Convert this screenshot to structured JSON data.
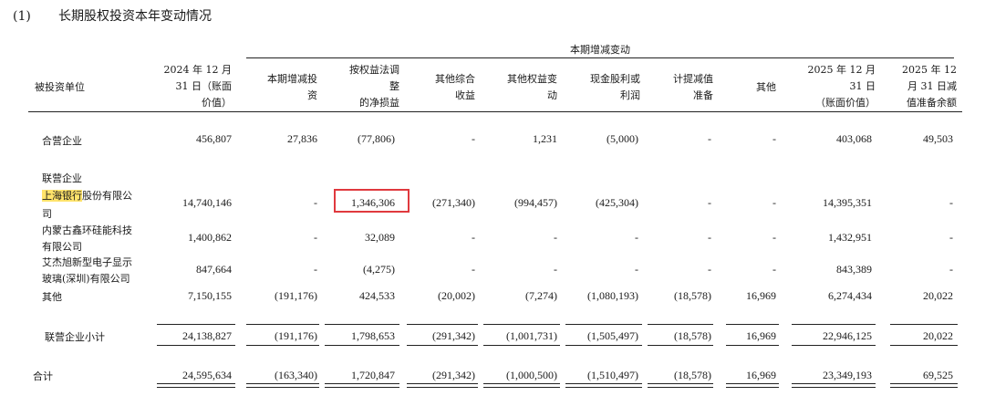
{
  "title": {
    "number": "(1)",
    "text": "长期股权投资本年变动情况"
  },
  "header": {
    "group": "本期增减变动",
    "col_investee": "被投资单位",
    "col_open": [
      "2024 年 12 月",
      "31 日（账面",
      "价值）"
    ],
    "col_increase": [
      "本期增减投",
      "资"
    ],
    "col_equity": [
      "按权益法调",
      "整",
      "的净损益"
    ],
    "col_oci": [
      "其他综合",
      "收益"
    ],
    "col_other_eq": [
      "其他权益变",
      "动"
    ],
    "col_dividend": [
      "现金股利或",
      "利润"
    ],
    "col_impair": [
      "计提减值",
      "准备"
    ],
    "col_other": [
      "其他"
    ],
    "col_close": [
      "2025 年 12 月",
      "31 日",
      "（账面价值）"
    ],
    "col_close_impair": [
      "2025 年 12",
      "月 31 日减",
      "值准备余额"
    ]
  },
  "rows": {
    "jv": {
      "name": "合营企业",
      "open": "456,807",
      "increase": "27,836",
      "equity": "(77,806)",
      "oci": "-",
      "other_eq": "1,231",
      "dividend": "(5,000)",
      "impair": "-",
      "other": "-",
      "close": "403,068",
      "close_impair": "49,503"
    },
    "assoc_label": "联营企业",
    "bank": {
      "name_hl": "上海银行",
      "name_rest": "股份有限公",
      "name2": "司",
      "open": "14,740,146",
      "increase": "-",
      "equity": "1,346,306",
      "oci": "(271,340)",
      "other_eq": "(994,457)",
      "dividend": "(425,304)",
      "impair": "-",
      "other": "-",
      "close": "14,395,351",
      "close_impair": "-"
    },
    "nmg": {
      "name1": "内蒙古鑫环硅能科技",
      "name2": "有限公司",
      "open": "1,400,862",
      "increase": "-",
      "equity": "32,089",
      "oci": "-",
      "other_eq": "-",
      "dividend": "-",
      "impair": "-",
      "other": "-",
      "close": "1,432,951",
      "close_impair": "-"
    },
    "ajx": {
      "name1": "艾杰旭新型电子显示",
      "name2": "玻璃(深圳)有限公司",
      "open": "847,664",
      "increase": "-",
      "equity": "(4,275)",
      "oci": "-",
      "other_eq": "-",
      "dividend": "-",
      "impair": "-",
      "other": "-",
      "close": "843,389",
      "close_impair": "-"
    },
    "others": {
      "name": "其他",
      "open": "7,150,155",
      "increase": "(191,176)",
      "equity": "424,533",
      "oci": "(20,002)",
      "other_eq": "(7,274)",
      "dividend": "(1,080,193)",
      "impair": "(18,578)",
      "other": "16,969",
      "close": "6,274,434",
      "close_impair": "20,022"
    },
    "subtotal": {
      "name": "联营企业小计",
      "open": "24,138,827",
      "increase": "(191,176)",
      "equity": "1,798,653",
      "oci": "(291,342)",
      "other_eq": "(1,001,731)",
      "dividend": "(1,505,497)",
      "impair": "(18,578)",
      "other": "16,969",
      "close": "22,946,125",
      "close_impair": "20,022"
    },
    "total": {
      "name": "合计",
      "open": "24,595,634",
      "increase": "(163,340)",
      "equity": "1,720,847",
      "oci": "(291,342)",
      "other_eq": "(1,000,500)",
      "dividend": "(1,510,497)",
      "impair": "(18,578)",
      "other": "16,969",
      "close": "23,349,193",
      "close_impair": "69,525"
    }
  },
  "colors": {
    "highlight": "#ffe36b",
    "annotation_box": "#e0393e"
  }
}
